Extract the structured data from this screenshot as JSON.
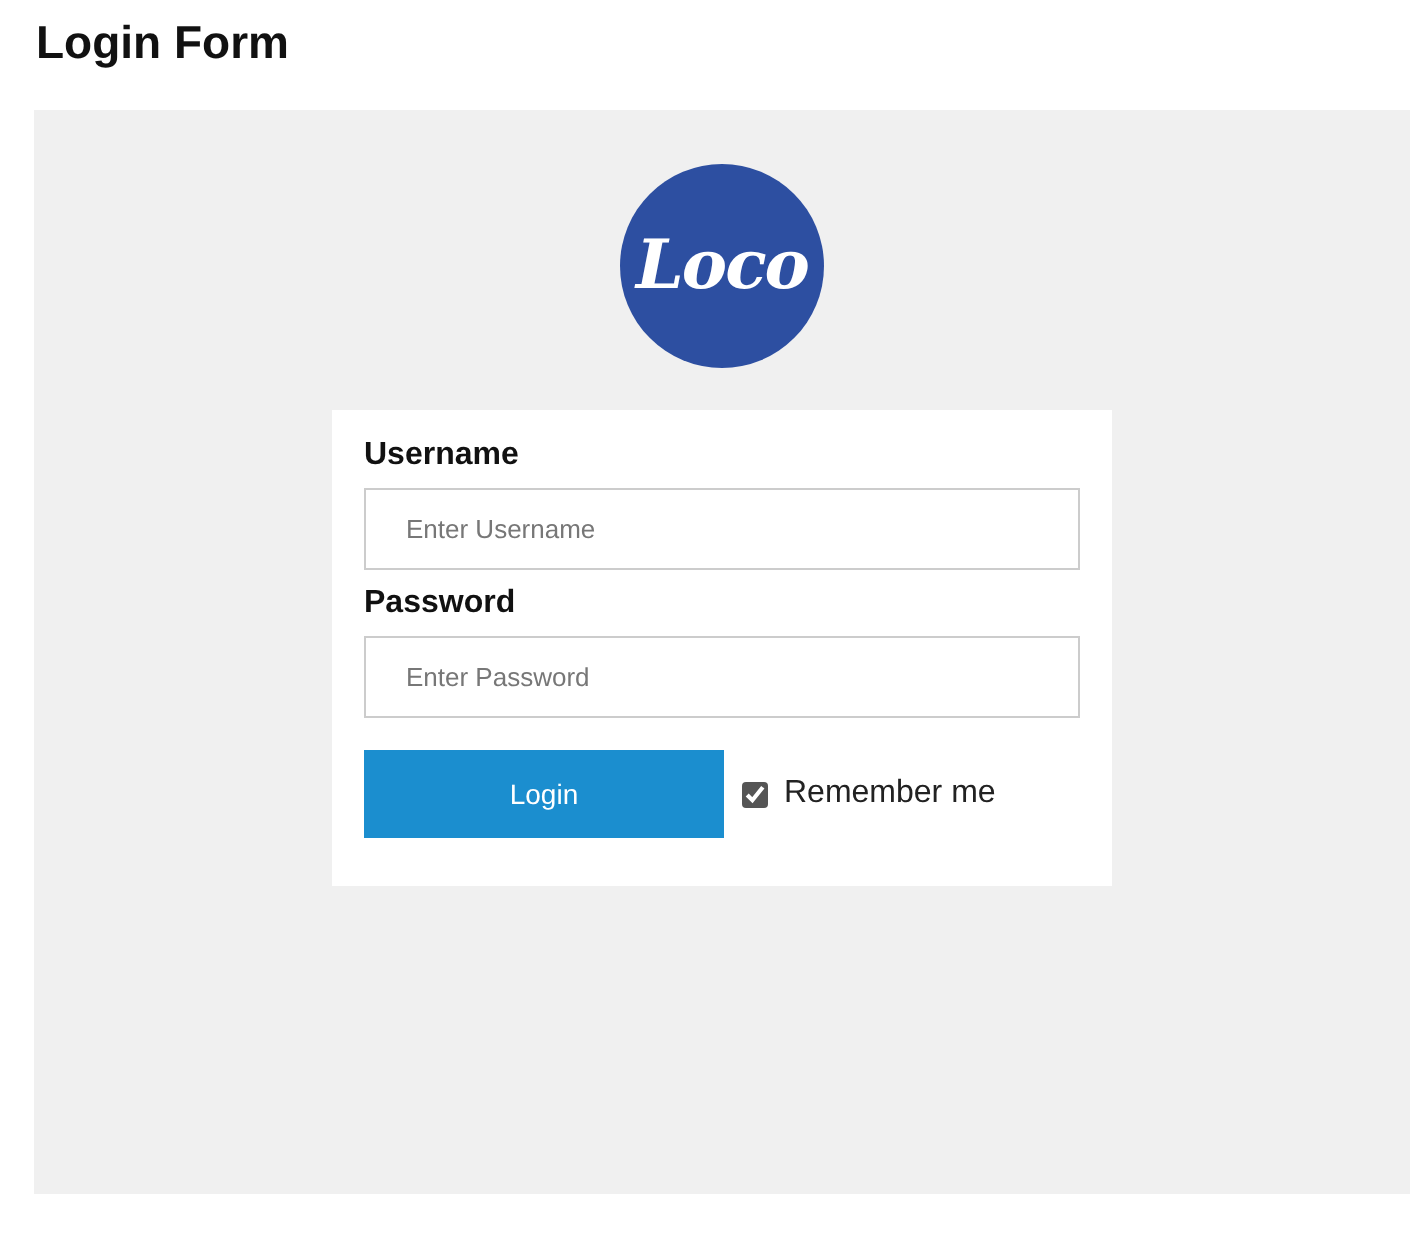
{
  "page_title": "Login Form",
  "logo": {
    "text": "Loco"
  },
  "form": {
    "fields": [
      {
        "label": "Username",
        "placeholder": "Enter Username"
      },
      {
        "label": "Password",
        "placeholder": "Enter Password"
      }
    ],
    "login_button": "Login",
    "remember": {
      "label": "Remember me",
      "checked": true
    }
  }
}
